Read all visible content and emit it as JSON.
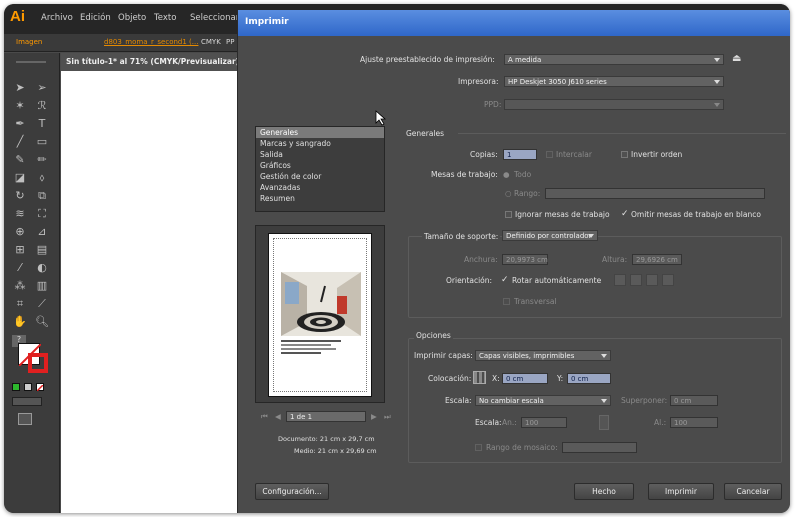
{
  "app": {
    "logo": "Ai",
    "menus": [
      "Archivo",
      "Edición",
      "Objeto",
      "Texto",
      "Seleccionar"
    ],
    "controlbar": {
      "image_label": "Imagen",
      "filename": "d803_moma_r_second1 (...",
      "color_mode": "CMYK",
      "extra": "PP"
    },
    "doc_tab": "Sin título-1* al 71% (CMYK/Previsualizar)"
  },
  "dialog": {
    "title": "Imprimir",
    "preset_label": "Ajuste preestablecido de impresión:",
    "preset_value": "A medida",
    "printer_label": "Impresora:",
    "printer_value": "HP Deskjet 3050 J610 series",
    "ppd_label": "PPD:",
    "ppd_value": "",
    "categories": [
      "Generales",
      "Marcas y sangrado",
      "Salida",
      "Gráficos",
      "Gestión de color",
      "Avanzadas",
      "Resumen"
    ],
    "selected_category": "Generales",
    "section_title": "Generales",
    "copies_label": "Copias:",
    "copies_value": "1",
    "collate_label": "Intercalar",
    "reverse_label": "Invertir orden",
    "artboards_label": "Mesas de trabajo:",
    "all_label": "Todo",
    "range_label": "Rango:",
    "ignore_artboards_label": "Ignorar mesas de trabajo",
    "skip_blank_label": "Omitir mesas de trabajo en blanco",
    "media_size_label": "Tamaño de soporte:",
    "media_size_value": "Definido por controlador",
    "width_label": "Anchura:",
    "width_value": "20,9973 cm",
    "height_label": "Altura:",
    "height_value": "29,6926 cm",
    "orientation_label": "Orientación:",
    "auto_rotate_label": "Rotar automáticamente",
    "transverse_label": "Transversal",
    "options_title": "Opciones",
    "print_layers_label": "Imprimir capas:",
    "print_layers_value": "Capas visibles, imprimibles",
    "placement_label": "Colocación:",
    "x_label": "X:",
    "x_value": "0 cm",
    "y_label": "Y:",
    "y_value": "0 cm",
    "scaling_label": "Escala:",
    "scaling_value": "No cambiar escala",
    "overlap_label": "Superponer:",
    "overlap_value": "0 cm",
    "scale_label": "Escala:",
    "scale_w_label": "An.:",
    "scale_w_value": "100",
    "scale_h_label": "Al.:",
    "scale_h_value": "100",
    "tile_range_label": "Rango de mosaico:",
    "page_nav": "1 de 1",
    "doc_size": "Documento: 21 cm x 29,7 cm",
    "media_size": "Medio: 21 cm x 29,69 cm",
    "setup_button": "Configuración...",
    "done_button": "Hecho",
    "print_button": "Imprimir",
    "cancel_button": "Cancelar"
  },
  "colors": {
    "title_blue": "#3b74d4",
    "ai_orange": "#ff9a00",
    "panel": "#4b4b4b",
    "selected": "#7a7a7a"
  }
}
